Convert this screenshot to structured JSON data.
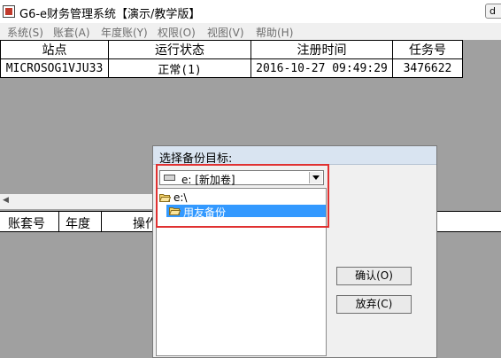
{
  "window": {
    "title": "G6-e财务管理系统【演示/教学版】",
    "btn_glyph": "d",
    "icon": "app-icon"
  },
  "menu": {
    "items": [
      "系统(S)",
      "账套(A)",
      "年度账(Y)",
      "权限(O)",
      "视图(V)",
      "帮助(H)"
    ]
  },
  "site_table": {
    "columns": [
      "站点",
      "运行状态",
      "注册时间",
      "任务号"
    ],
    "rows": [
      [
        "MICROSOG1VJU33",
        "正常(1)",
        "2016-10-27 09:49:29",
        "3476622"
      ]
    ]
  },
  "account_table": {
    "columns": [
      "账套号",
      "年度",
      "操作"
    ]
  },
  "dialog": {
    "title": "选择备份目标:",
    "drive_label": "e: [新加卷]",
    "directories": [
      "e:\\",
      "用友备份"
    ],
    "selected_directory": "用友备份",
    "confirm_label": "确认(O)",
    "cancel_label": "放弃(C)"
  },
  "colors": {
    "highlight_border": "#e03131",
    "selection": "#3399ff",
    "desktop": "#a0a0a0"
  }
}
